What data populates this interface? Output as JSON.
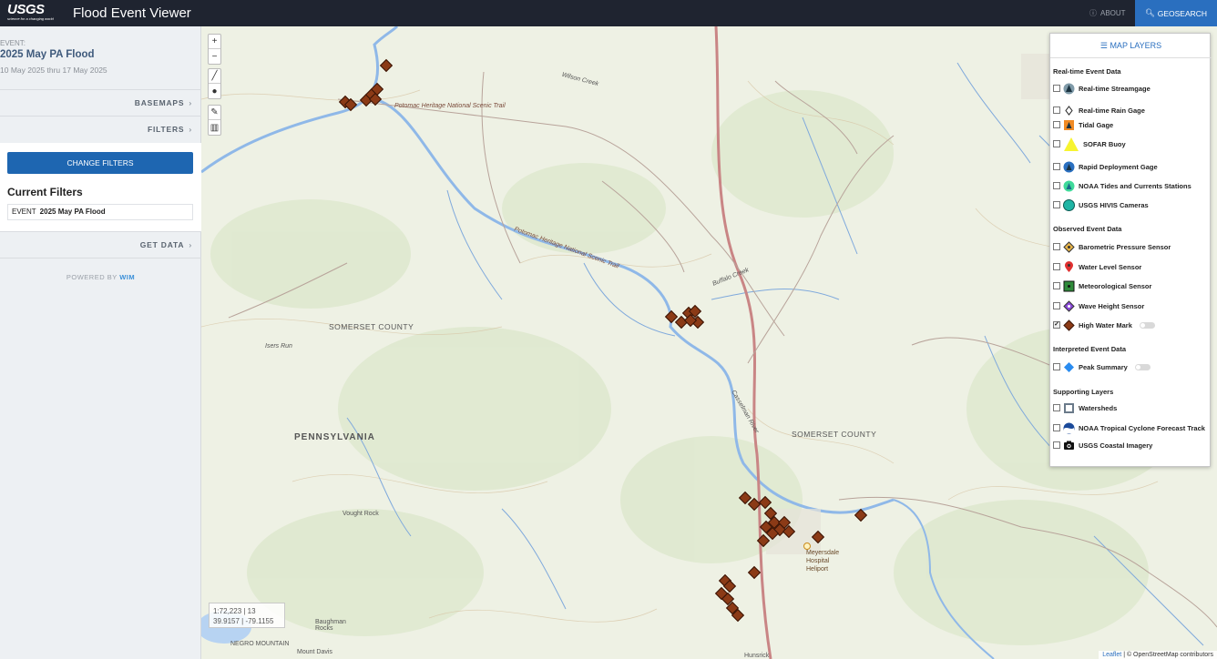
{
  "header": {
    "logo_text": "USGS",
    "logo_tagline": "science for a changing world",
    "title": "Flood Event Viewer",
    "about_label": "ABOUT",
    "geosearch_label": "GEOSEARCH"
  },
  "sidebar": {
    "event_label": "EVENT:",
    "event_name": "2025 May PA Flood",
    "event_dates": "10 May 2025 thru 17 May 2025",
    "basemaps_label": "BASEMAPS",
    "filters_label": "FILTERS",
    "change_filters_label": "CHANGE FILTERS",
    "current_filters_title": "Current Filters",
    "filter_key": "EVENT",
    "filter_value": "2025 May PA Flood",
    "get_data_label": "GET DATA",
    "powered_by": "POWERED BY",
    "powered_brand": "WIM"
  },
  "map": {
    "zoom_in": "+",
    "zoom_out": "−",
    "scale_text": "1:72,223 | 13",
    "coords_text": "39.9157 | -79.1155",
    "attribution_leaflet": "Leaflet",
    "attribution_rest": " | © OpenStreetMap contributors",
    "labels": {
      "potomac1": "Potomac Heritage National Scenic Trail",
      "potomac2": "Potomac Heritage National Scenic Trail",
      "somerset1": "SOMERSET COUNTY",
      "somerset2": "SOMERSET COUNTY",
      "pennsylvania": "PENNSYLVANIA",
      "meyersdale": "Meyersdale Hospital Heliport",
      "buffalo": "Buffalo Creek",
      "wilson": "Wilson Creek",
      "casselman": "Casselman River",
      "isers": "Isers Run",
      "vought": "Vought Rock",
      "baughman": "Baughman Rocks",
      "negro": "NEGRO MOUNTAIN",
      "mount_davis": "Mount Davis",
      "hunsrick": "Hunsrick"
    }
  },
  "legend": {
    "title": "MAP LAYERS",
    "sections": {
      "realtime": "Real-time Event Data",
      "observed": "Observed Event Data",
      "interpreted": "Interpreted Event Data",
      "supporting": "Supporting Layers"
    },
    "items": {
      "streamgage": "Real-time Streamgage",
      "raingage": "Real-time Rain Gage",
      "tidal": "Tidal Gage",
      "sofar": "SOFAR Buoy",
      "rapid": "Rapid Deployment Gage",
      "noaa_tides": "NOAA Tides and Currents Stations",
      "hivis": "USGS HIVIS Cameras",
      "baro": "Barometric Pressure Sensor",
      "water_level": "Water Level Sensor",
      "met": "Meteorological Sensor",
      "wave": "Wave Height Sensor",
      "hwm": "High Water Mark",
      "peak": "Peak Summary",
      "watersheds": "Watersheds",
      "cyclone": "NOAA Tropical Cyclone Forecast Track",
      "coastal": "USGS Coastal Imagery"
    },
    "checked": {
      "hwm": true
    }
  },
  "colors": {
    "header_bg": "#1f2430",
    "geosearch_bg": "#2a6fbf",
    "change_filters_bg": "#1e66b1",
    "high_water_mark": "#8b3a16",
    "river": "#8fb8e8",
    "highway": "#c98585"
  }
}
